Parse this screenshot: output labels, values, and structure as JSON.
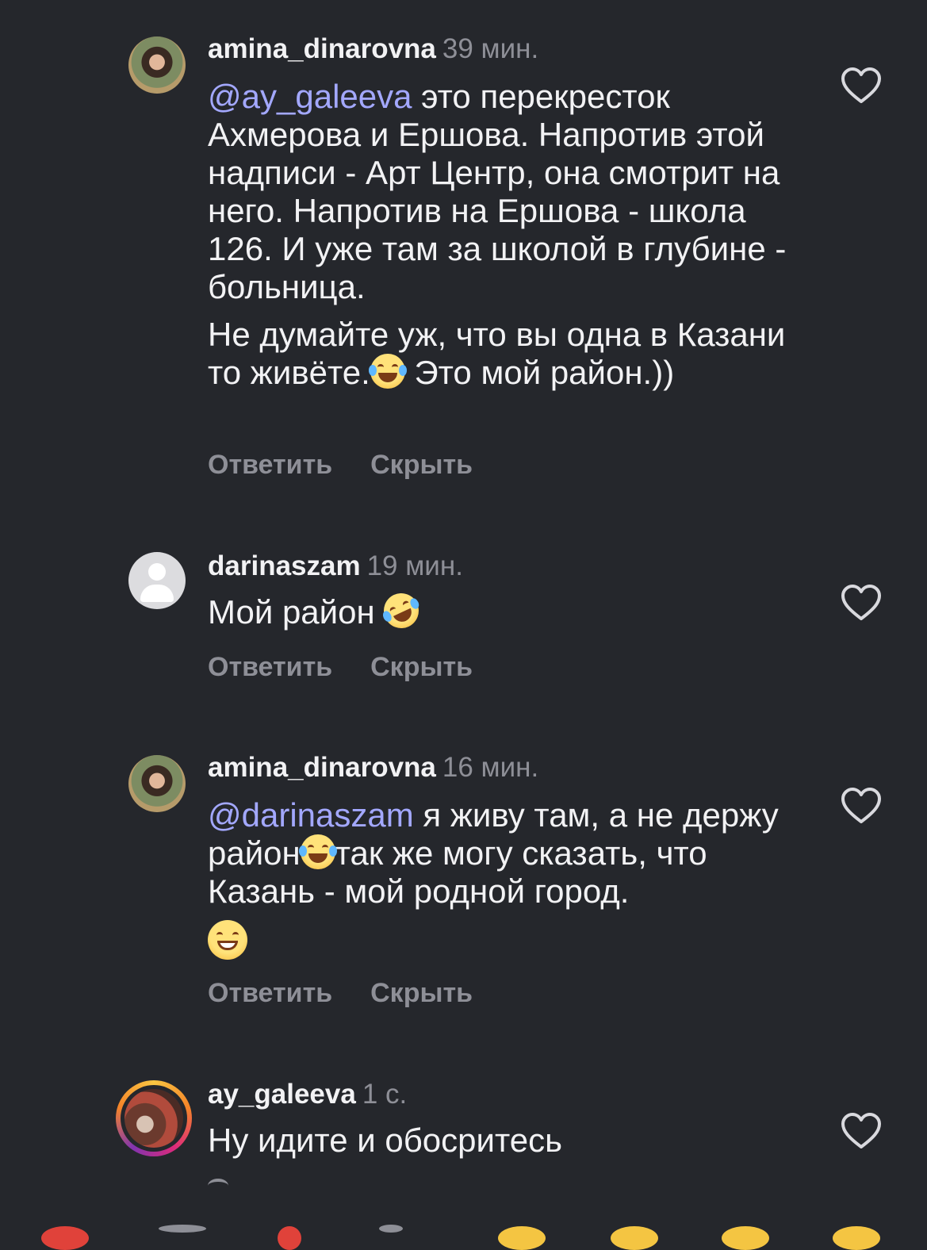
{
  "comments": [
    {
      "username": "amina_dinarovna",
      "time": "39 мин.",
      "mention": "@ay_galeeva",
      "text1": " это перекресток Ахмерова и Ершова. Напротив этой надписи - Арт Центр, она смотрит на него. Напротив на Ершова - школа 126. И уже там за школой в глубине - больница.",
      "text2a": "Не думайте уж, что вы одна в Казани то живёте.",
      "text2b": " Это мой район.))",
      "reply": "Ответить",
      "hide": "Скрыть"
    },
    {
      "username": "darinaszam",
      "time": "19 мин.",
      "text": "Мой район ",
      "reply": "Ответить",
      "hide": "Скрыть"
    },
    {
      "username": "amina_dinarovna",
      "time": "16 мин.",
      "mention": "@darinaszam",
      "text1": " я живу там, а не держу район",
      "text1b": "так же могу сказать, что Казань - мой родной город.",
      "reply": "Ответить",
      "hide": "Скрыть"
    },
    {
      "username": "ay_galeeva",
      "time": "1 с.",
      "text": "Ну идите и обосритесь"
    }
  ],
  "icons": {
    "like": "heart-outline-icon",
    "emoji_laugh": "face-with-tears-of-joy",
    "emoji_rofl": "rolling-on-floor-laughing",
    "emoji_grin": "grinning-face"
  },
  "colors": {
    "background": "#25272c",
    "mention": "#a3a8ff",
    "secondary_text": "#8e8f97"
  }
}
